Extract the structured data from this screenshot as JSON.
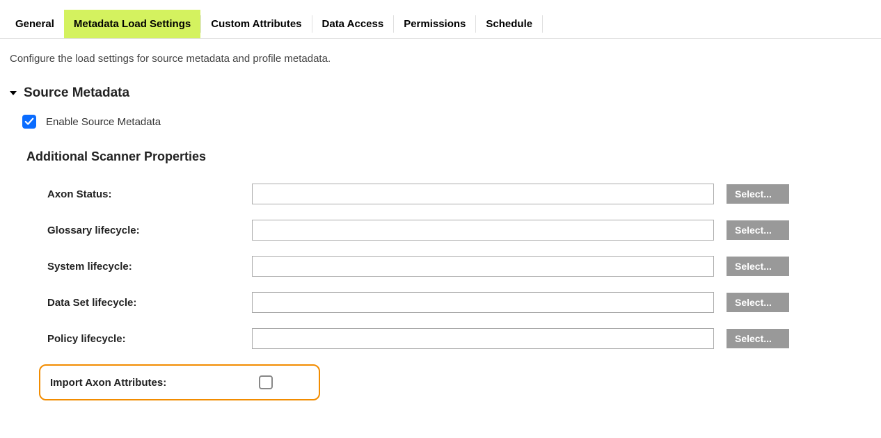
{
  "tabs": {
    "general": "General",
    "metadata_load_settings": "Metadata Load Settings",
    "custom_attributes": "Custom Attributes",
    "data_access": "Data Access",
    "permissions": "Permissions",
    "schedule": "Schedule"
  },
  "description": "Configure the load settings for source metadata and profile metadata.",
  "section": {
    "title": "Source Metadata",
    "enable_label": "Enable Source Metadata"
  },
  "subsection": {
    "title": "Additional Scanner Properties"
  },
  "properties": {
    "axon_status": {
      "label": "Axon Status:",
      "value": "",
      "button": "Select..."
    },
    "glossary_lifecycle": {
      "label": "Glossary lifecycle:",
      "value": "",
      "button": "Select..."
    },
    "system_lifecycle": {
      "label": "System lifecycle:",
      "value": "",
      "button": "Select..."
    },
    "data_set_lifecycle": {
      "label": "Data Set lifecycle:",
      "value": "",
      "button": "Select..."
    },
    "policy_lifecycle": {
      "label": "Policy lifecycle:",
      "value": "",
      "button": "Select..."
    },
    "import_axon_attributes": {
      "label": "Import Axon Attributes:"
    }
  }
}
